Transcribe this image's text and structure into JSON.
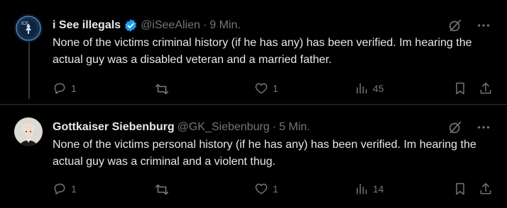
{
  "posts": [
    {
      "author": "i See illegals",
      "verified": true,
      "handle": "@iSeeAlien",
      "separator": "·",
      "time": "9 Min.",
      "text": "None of the victims criminal history (if he has any) has been verified. Im hearing the actual guy was a disabled veteran and a married father.",
      "replies": "1",
      "reposts": "",
      "likes": "1",
      "views": "45",
      "avatar_icon": "ice-logo-avatar"
    },
    {
      "author": "Gottkaiser Siebenburg",
      "verified": false,
      "handle": "@GK_Siebenburg",
      "separator": "·",
      "time": "5 Min.",
      "text": "None of the victims personal history (if he has any) has been verified. Im hearing the actual guy was a criminal and a violent thug.",
      "replies": "1",
      "reposts": "",
      "likes": "1",
      "views": "14",
      "avatar_icon": "anime-avatar"
    }
  ],
  "colors": {
    "background": "#000000",
    "text": "#e7e9ea",
    "muted": "#71767b",
    "verified": "#1d9bf0"
  }
}
